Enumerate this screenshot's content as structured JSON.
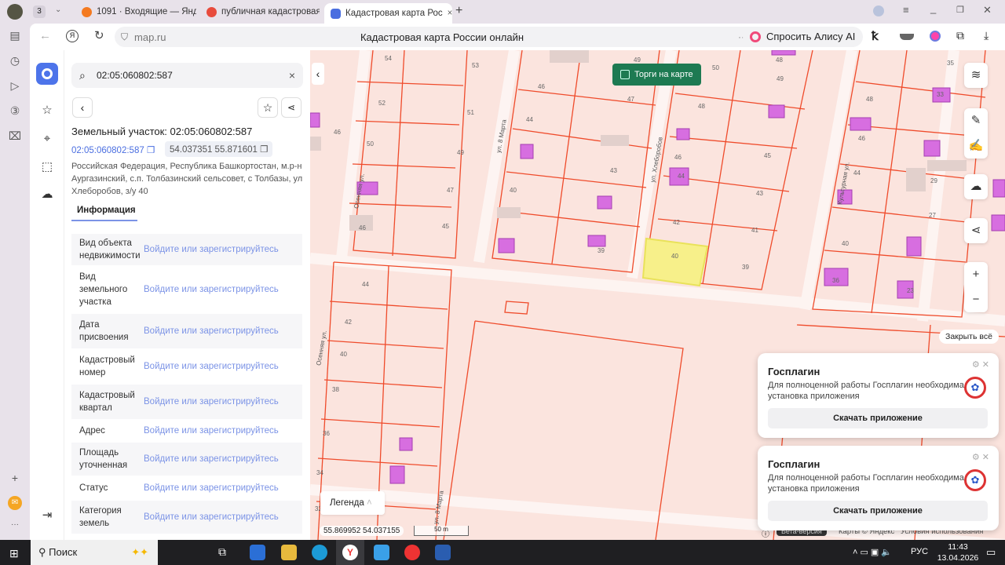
{
  "browser": {
    "tab_count": "3",
    "tabs": [
      {
        "label": "1091 · Входящие — Яндекс"
      },
      {
        "label": "публичная кадастровая к"
      },
      {
        "label": "Кадастровая карта Рос"
      }
    ],
    "url": "map.ru",
    "page_title": "Кадастровая карта России онлайн",
    "alice": "Спросить Алису AI"
  },
  "panel": {
    "search_value": "02:05:060802:587",
    "title": "Земельный участок: 02:05:060802:587",
    "cad_number": "02:05:060802:587",
    "coords": "54.037351 55.871601",
    "address": "Российская Федерация, Республика Башкортостан, м.р-н Аургазинский, с.п. Толбазинский сельсовет, с Толбазы, ул Хлеборобов, з/у 40",
    "tab": "Информация",
    "rows": [
      {
        "label": "Вид объекта недвижимости",
        "value": "Войдите или зарегистрируйтесь"
      },
      {
        "label": "Вид земельного участка",
        "value": "Войдите или зарегистрируйтесь"
      },
      {
        "label": "Дата присвоения",
        "value": "Войдите или зарегистрируйтесь"
      },
      {
        "label": "Кадастровый номер",
        "value": "Войдите или зарегистрируйтесь"
      },
      {
        "label": "Кадастровый квартал",
        "value": "Войдите или зарегистрируйтесь"
      },
      {
        "label": "Адрес",
        "value": "Войдите или зарегистрируйтесь"
      },
      {
        "label": "Площадь уточненная",
        "value": "Войдите или зарегистрируйтесь"
      },
      {
        "label": "Статус",
        "value": "Войдите или зарегистрируйтесь"
      },
      {
        "label": "Категория земель",
        "value": "Войдите или зарегистрируйтесь"
      }
    ]
  },
  "map": {
    "torgi": "Торги на карте",
    "legend": "Легенда",
    "cursor_coords": "55.869952  54.037155",
    "scale": "50 m",
    "close_all": "Закрыть всё",
    "beta": "Бета-версия",
    "copyright": "Карты © Яндекс",
    "terms": "Условия использования",
    "streets": [
      "Осенняя ул.",
      "ул. 8 Марта",
      "ул. Хлеборобов",
      "Культурная ул.",
      "ул. 8 Марта",
      "Осенняя ул."
    ],
    "parcels": [
      "54",
      "53",
      "52",
      "51",
      "50",
      "49",
      "47",
      "45",
      "46",
      "46",
      "44",
      "42",
      "40",
      "38",
      "46",
      "44",
      "43",
      "40",
      "39",
      "49",
      "48",
      "47",
      "46",
      "45",
      "44",
      "43",
      "42",
      "41",
      "40",
      "39",
      "50",
      "49",
      "48",
      "46",
      "44",
      "40",
      "36",
      "48",
      "35",
      "33",
      "29",
      "27",
      "23",
      "42",
      "44",
      "38",
      "36",
      "34",
      "32"
    ]
  },
  "notifications": [
    {
      "title": "Госплагин",
      "text": "Для полноценной работы Госплагин необходима установка приложения",
      "button": "Скачать приложение"
    },
    {
      "title": "Госплагин",
      "text": "Для полноценной работы Госплагин необходима установка приложения",
      "button": "Скачать приложение"
    }
  ],
  "taskbar": {
    "search": "Поиск",
    "lang": "РУС",
    "time": "11:43",
    "date": "13.04.2026"
  }
}
